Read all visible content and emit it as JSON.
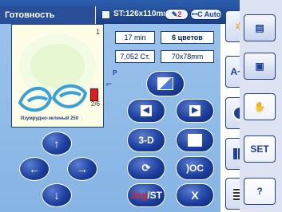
{
  "status": {
    "title": "Готовность",
    "size_label": "ST:126x110mm",
    "color_count": "2",
    "auto_label": "Auto"
  },
  "readouts": {
    "time": "17 min",
    "colors": "6 цветов",
    "stitches": "7,052 Ст.",
    "dimensions": "70x78mm"
  },
  "preview": {
    "number": "1",
    "fraction": "2/6",
    "thread_name": "Изумрудно-зеленый 250",
    "colors": {
      "leaves": "#3aa0d8",
      "glow": "#dff4c8",
      "spool": "#e02020"
    }
  },
  "buttons": {
    "three_d": "3-D",
    "jog_label": "Jog",
    "st_label": "ST",
    "x_label": "X"
  },
  "rail": {
    "az_label": "A~Z",
    "set_label": "SET",
    "help_label": "?"
  },
  "theme": {
    "accent": "#1d3fa0",
    "statusbar": "#2c5fae",
    "screen_bg": "#9bc4ec"
  }
}
